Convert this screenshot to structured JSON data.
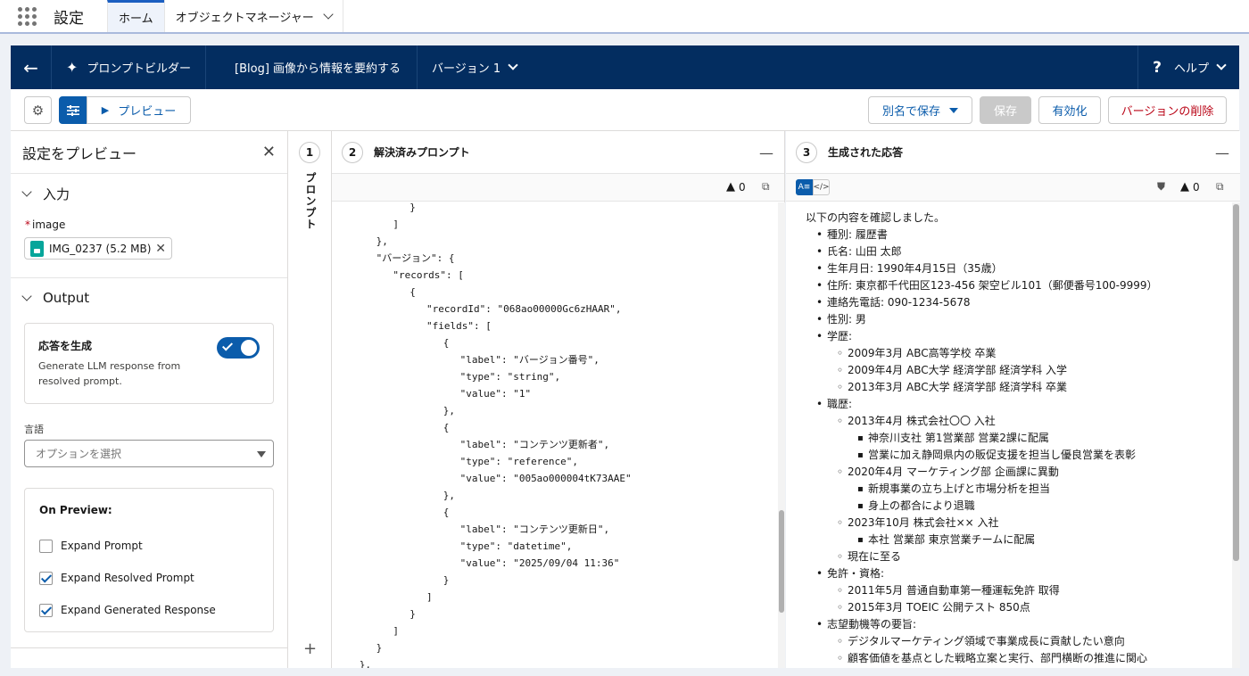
{
  "appbar": {
    "app_name": "設定",
    "tabs": [
      {
        "label": "ホーム"
      },
      {
        "label": "オブジェクトマネージャー"
      }
    ]
  },
  "builder_header": {
    "builder_label": "プロンプトビルダー",
    "template_name": "[Blog] 画像から情報を要約する",
    "version_label": "バージョン 1",
    "help_label": "ヘルプ"
  },
  "toolbar": {
    "preview_label": "プレビュー",
    "save_as_label": "別名で保存",
    "save_label": "保存",
    "activate_label": "有効化",
    "delete_version_label": "バージョンの削除"
  },
  "preview_settings": {
    "title": "設定をプレビュー",
    "input_section": "入力",
    "image_label": "image",
    "image_file": "IMG_0237 (5.2 MB)",
    "output_section": "Output",
    "generate_title": "応答を生成",
    "generate_desc": "Generate LLM response from resolved prompt.",
    "generate_enabled": true,
    "language_label": "言語",
    "language_placeholder": "オプションを選択",
    "on_preview_title": "On Preview:",
    "on_preview_options": [
      {
        "label": "Expand Prompt",
        "checked": false
      },
      {
        "label": "Expand Resolved Prompt",
        "checked": true
      },
      {
        "label": "Expand Generated Response",
        "checked": true
      }
    ]
  },
  "prompt_strip": {
    "number": "1",
    "label": "プロンプト"
  },
  "resolved_panel": {
    "number": "2",
    "title": "解決済みプロンプト",
    "warnings": "0",
    "code_lines": [
      {
        "indent": 4,
        "text": "}"
      },
      {
        "indent": 3,
        "text": "]"
      },
      {
        "indent": 2,
        "text": "},"
      },
      {
        "indent": 2,
        "text": "\"バージョン\": {"
      },
      {
        "indent": 3,
        "text": "\"records\": ["
      },
      {
        "indent": 4,
        "text": "{"
      },
      {
        "indent": 5,
        "text": "\"recordId\": \"068ao00000Gc6zHAAR\","
      },
      {
        "indent": 5,
        "text": "\"fields\": ["
      },
      {
        "indent": 6,
        "text": "{"
      },
      {
        "indent": 7,
        "text": "\"label\": \"バージョン番号\","
      },
      {
        "indent": 7,
        "text": "\"type\": \"string\","
      },
      {
        "indent": 7,
        "text": "\"value\": \"1\""
      },
      {
        "indent": 6,
        "text": "},"
      },
      {
        "indent": 6,
        "text": "{"
      },
      {
        "indent": 7,
        "text": "\"label\": \"コンテンツ更新者\","
      },
      {
        "indent": 7,
        "text": "\"type\": \"reference\","
      },
      {
        "indent": 7,
        "text": "\"value\": \"005ao000004tK73AAE\""
      },
      {
        "indent": 6,
        "text": "},"
      },
      {
        "indent": 6,
        "text": "{"
      },
      {
        "indent": 7,
        "text": "\"label\": \"コンテンツ更新日\","
      },
      {
        "indent": 7,
        "text": "\"type\": \"datetime\","
      },
      {
        "indent": 7,
        "text": "\"value\": \"2025/09/04 11:36\""
      },
      {
        "indent": 6,
        "text": "}"
      },
      {
        "indent": 5,
        "text": "]"
      },
      {
        "indent": 4,
        "text": "}"
      },
      {
        "indent": 3,
        "text": "]"
      },
      {
        "indent": 2,
        "text": "}"
      },
      {
        "indent": 1,
        "text": "},"
      }
    ]
  },
  "response_panel": {
    "number": "3",
    "title": "生成された応答",
    "warnings": "0",
    "lines": [
      {
        "level": 0,
        "text": "以下の内容を確認しました。"
      },
      {
        "level": 1,
        "text": "種別: 履歴書"
      },
      {
        "level": 1,
        "text": "氏名: 山田 太郎"
      },
      {
        "level": 1,
        "text": "生年月日: 1990年4月15日（35歳）"
      },
      {
        "level": 1,
        "text": "住所: 東京都千代田区123-456 架空ビル101（郵便番号100-9999）"
      },
      {
        "level": 1,
        "text": "連絡先電話: 090-1234-5678"
      },
      {
        "level": 1,
        "text": "性別: 男"
      },
      {
        "level": 1,
        "text": "学歴:"
      },
      {
        "level": 2,
        "text": "2009年3月 ABC高等学校 卒業"
      },
      {
        "level": 2,
        "text": "2009年4月 ABC大学 経済学部 経済学科 入学"
      },
      {
        "level": 2,
        "text": "2013年3月 ABC大学 経済学部 経済学科 卒業"
      },
      {
        "level": 1,
        "text": "職歴:"
      },
      {
        "level": 2,
        "text": "2013年4月 株式会社〇〇 入社"
      },
      {
        "level": 3,
        "text": "神奈川支社 第1営業部 営業2課に配属"
      },
      {
        "level": 3,
        "text": "営業に加え静岡県内の販促支援を担当し優良営業を表彰"
      },
      {
        "level": 2,
        "text": "2020年4月 マーケティング部 企画課に異動"
      },
      {
        "level": 3,
        "text": "新規事業の立ち上げと市場分析を担当"
      },
      {
        "level": 3,
        "text": "身上の都合により退職"
      },
      {
        "level": 2,
        "text": "2023年10月 株式会社×× 入社"
      },
      {
        "level": 3,
        "text": "本社 営業部 東京営業チームに配属"
      },
      {
        "level": 2,
        "text": "現在に至る"
      },
      {
        "level": 1,
        "text": "免許・資格:"
      },
      {
        "level": 2,
        "text": "2011年5月 普通自動車第一種運転免許 取得"
      },
      {
        "level": 2,
        "text": "2015年3月 TOEIC 公開テスト 850点"
      },
      {
        "level": 1,
        "text": "志望動機等の要旨:"
      },
      {
        "level": 2,
        "text": "デジタルマーケティング領域で事業成長に貢献したい意向"
      },
      {
        "level": 2,
        "text": "顧客価値を基点とした戦略立案と実行、部門横断の推進に関心"
      }
    ]
  }
}
